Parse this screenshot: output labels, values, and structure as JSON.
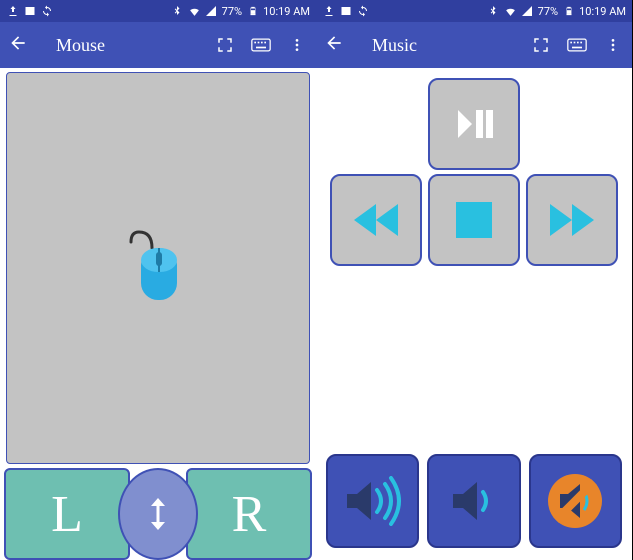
{
  "statusbar": {
    "battery_pct": "77%",
    "time": "10:19 AM"
  },
  "left": {
    "title": "Mouse",
    "buttons": {
      "left": "L",
      "right": "R"
    }
  },
  "right": {
    "title": "Music"
  }
}
